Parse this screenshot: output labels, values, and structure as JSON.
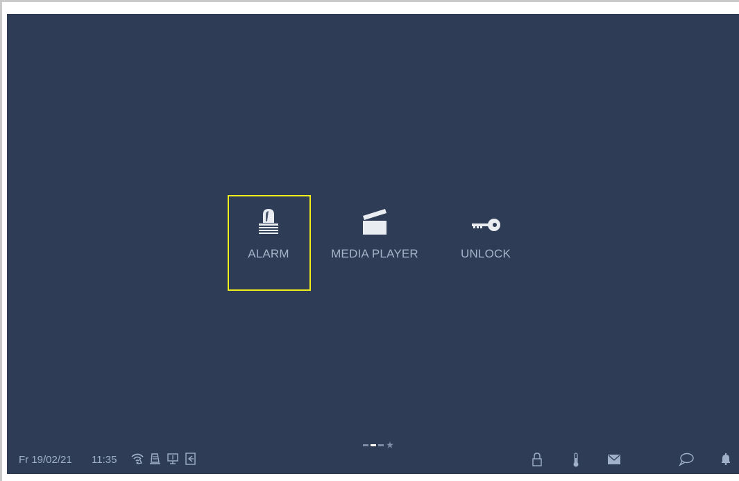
{
  "apps": [
    {
      "id": "alarm",
      "label": "ALARM",
      "icon": "alarm-siren-icon",
      "focused": true
    },
    {
      "id": "media_player",
      "label": "MEDIA PLAYER",
      "icon": "clapperboard-icon",
      "focused": false
    },
    {
      "id": "unlock",
      "label": "UNLOCK",
      "icon": "key-icon",
      "focused": false
    }
  ],
  "pager": {
    "pages": 3,
    "active_page": 2,
    "has_favorites": true
  },
  "status_bar": {
    "date": "Fr 19/02/21",
    "time": "11:35",
    "left_icons": [
      "wifi-icon",
      "intercom-icon",
      "monitor-icon",
      "door-icon"
    ],
    "right_icons": [
      "padlock-icon",
      "thermometer-icon",
      "envelope-icon",
      "speech-bubble-icon",
      "bell-icon"
    ]
  },
  "colors": {
    "background": "#2e3d55",
    "label": "#a5b3c8",
    "focus": "#f2ee1a"
  }
}
